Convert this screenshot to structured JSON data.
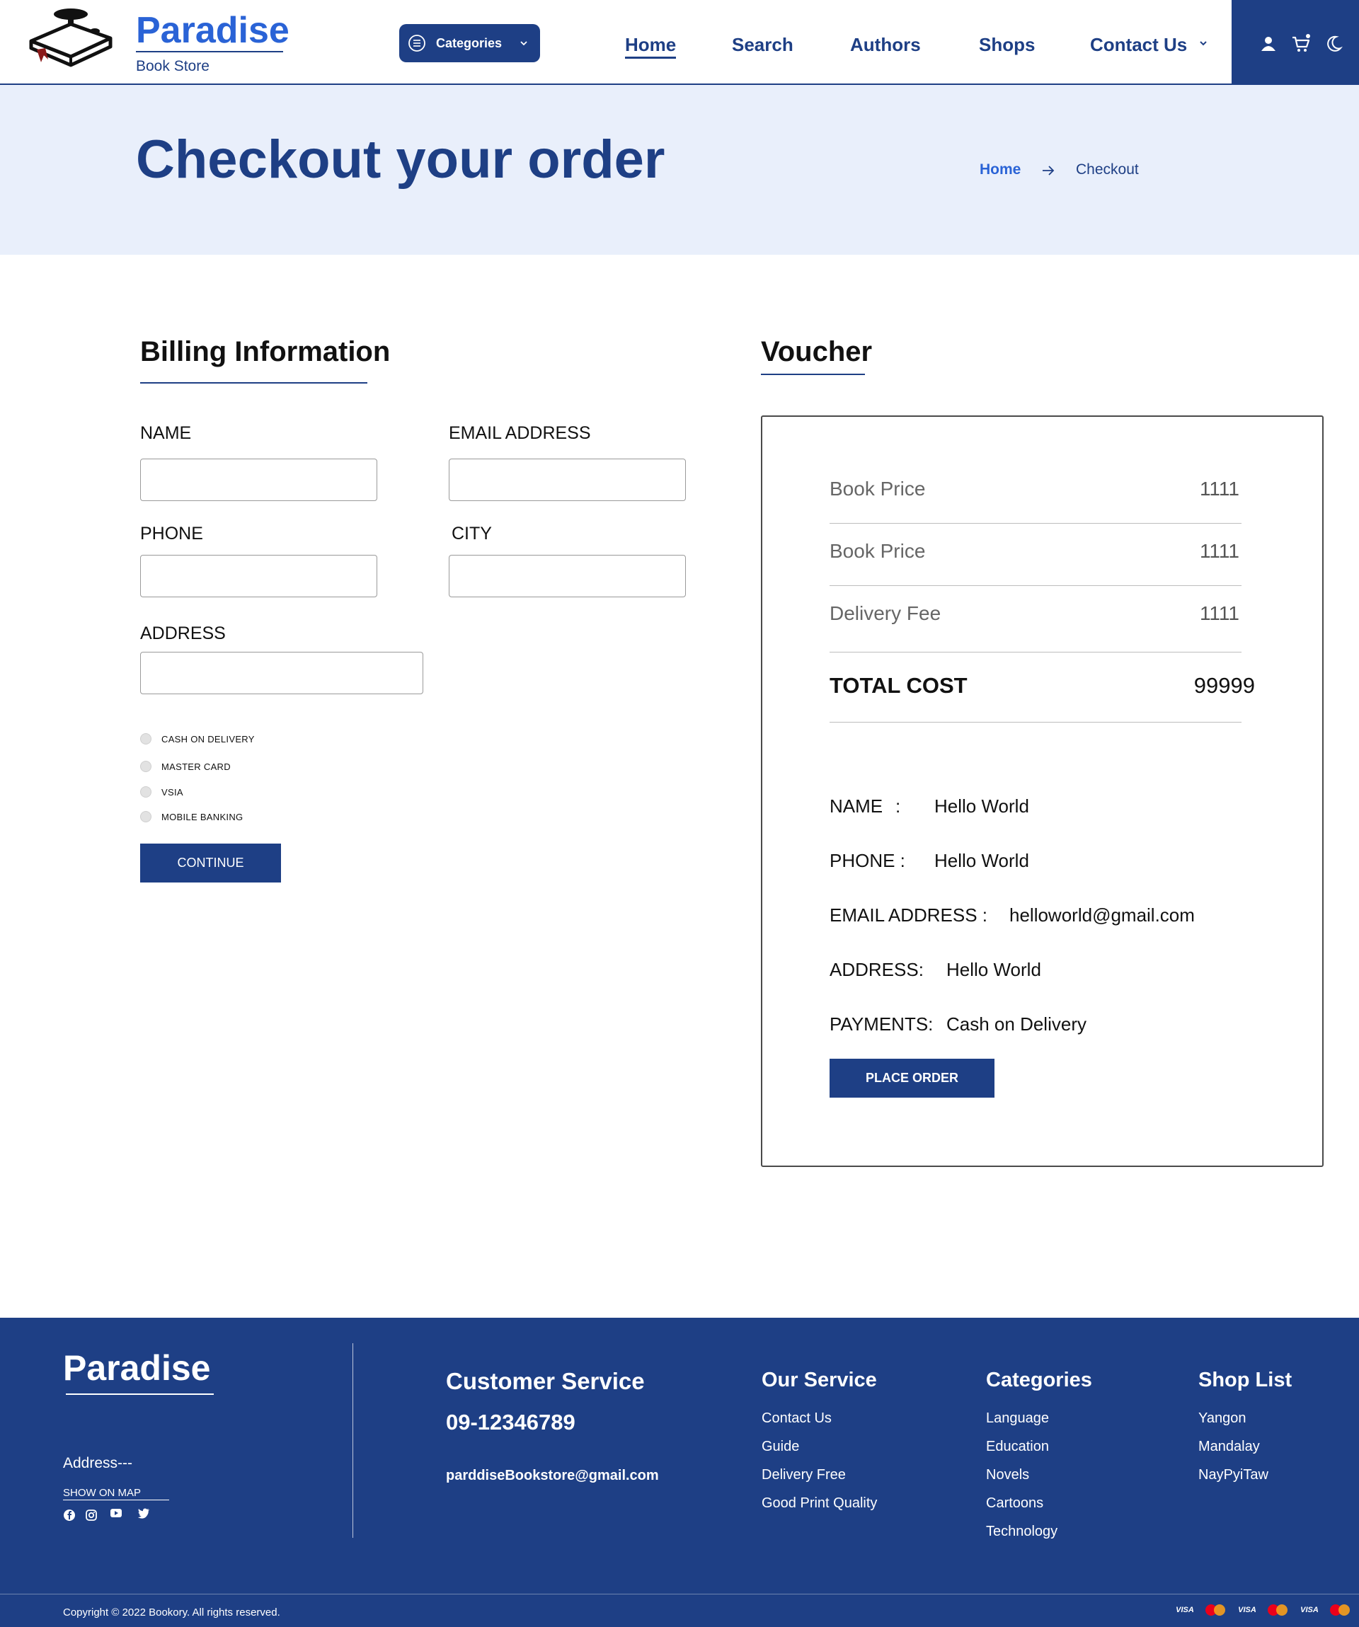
{
  "header": {
    "brand_title": "Paradise",
    "brand_subtitle": "Book Store",
    "categories_label": "Categories",
    "nav": [
      {
        "label": "Home",
        "active": true
      },
      {
        "label": "Search"
      },
      {
        "label": "Authors"
      },
      {
        "label": "Shops"
      },
      {
        "label": "Contact Us"
      }
    ],
    "icons": [
      "user-icon",
      "cart-icon",
      "moon-icon"
    ]
  },
  "banner": {
    "title": "Checkout your order",
    "breadcrumb_home": "Home",
    "breadcrumb_current": "Checkout"
  },
  "billing": {
    "title": "Billing Information",
    "name_label": "NAME",
    "email_label": "EMAIL ADDRESS",
    "phone_label": "PHONE",
    "city_label": "CITY",
    "address_label": "ADDRESS",
    "payment_options": [
      "CASH ON DELIVERY",
      "MASTER CARD",
      "VSIA",
      "MOBILE BANKING"
    ],
    "continue_label": "CONTINUE"
  },
  "voucher": {
    "title": "Voucher",
    "rows": [
      {
        "label": "Book Price",
        "value": "1111"
      },
      {
        "label": "Book Price",
        "value": "1111"
      },
      {
        "label": "Delivery Fee",
        "value": "1111"
      }
    ],
    "total_label": "TOTAL COST",
    "total_value": "99999",
    "info": {
      "name_key": "NAME",
      "name_sep": ":",
      "name_val": "Hello World",
      "phone_key": "PHONE :",
      "phone_val": "Hello World",
      "email_key": "EMAIL ADDRESS :",
      "email_val": "helloworld@gmail.com",
      "address_key": "ADDRESS:",
      "address_val": "Hello World",
      "payments_key": "PAYMENTS:",
      "payments_val": "Cash on Delivery"
    },
    "place_order_label": "PLACE ORDER"
  },
  "footer": {
    "brand": "Paradise",
    "address": "Address---",
    "show_on_map": "SHOW ON MAP",
    "social_icons": [
      "facebook-icon",
      "instagram-icon",
      "youtube-icon",
      "twitter-icon"
    ],
    "customer_service_title": "Customer Service",
    "phone": "09-12346789",
    "email": "parddiseBookstore@gmail.com",
    "our_service": {
      "title": "Our Service",
      "items": [
        "Contact Us",
        "Guide",
        "Delivery Free",
        "Good Print Quality"
      ]
    },
    "categories": {
      "title": "Categories",
      "items": [
        "Language",
        "Education",
        "Novels",
        "Cartoons",
        "Technology"
      ]
    },
    "shop_list": {
      "title": "Shop List",
      "items": [
        "Yangon",
        "Mandalay",
        "NayPyiTaw"
      ]
    },
    "copyright": "Copyright © 2022 Bookory. All rights reserved.",
    "payment_badges": [
      "VISA",
      "MasterCard",
      "VISA",
      "MasterCard",
      "VISA",
      "MasterCard"
    ]
  },
  "colors": {
    "primary": "#1e3f85",
    "brand_blue": "#2a63d6",
    "banner_bg": "#e9effb"
  }
}
